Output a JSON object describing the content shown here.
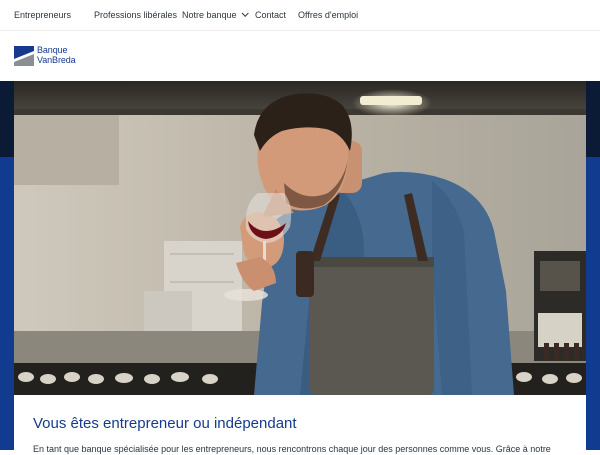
{
  "topnav": {
    "items": [
      {
        "label": "Entrepreneurs"
      },
      {
        "label": "Professions libérales"
      },
      {
        "label": "Notre banque"
      },
      {
        "label": "Contact"
      },
      {
        "label": "Offres d'emploi"
      }
    ]
  },
  "brand": {
    "line1": "Banque",
    "line2": "VanBreda",
    "colors": {
      "navy": "#173a8c",
      "grey": "#8a8f96"
    }
  },
  "hero": {
    "image_alt": "Homme en tablier goûtant un verre de vin rouge dans une cave",
    "panel_color": "#103b8e"
  },
  "intro": {
    "title": "Vous êtes entrepreneur ou indépendant",
    "body": "En tant que banque spécialisée pour les entrepreneurs, nous rencontrons chaque jour des personnes comme vous. Grâce à notre"
  }
}
